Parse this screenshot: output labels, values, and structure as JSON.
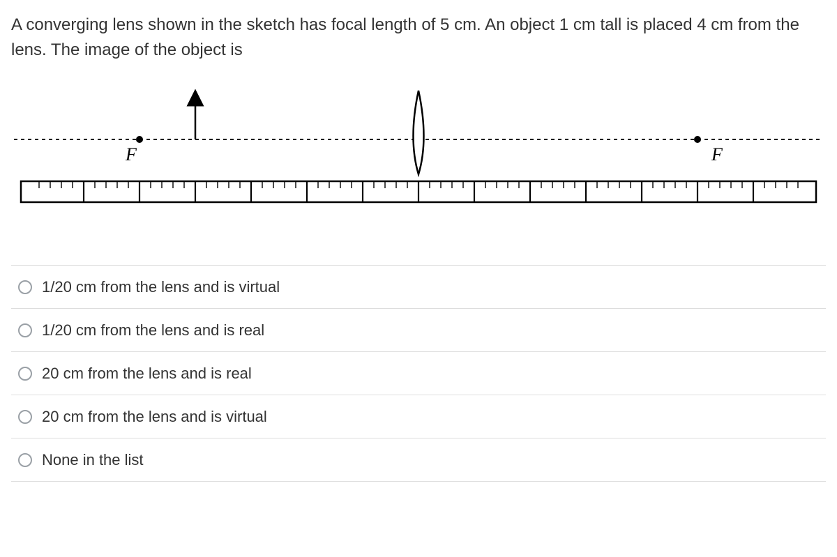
{
  "question": "A converging lens shown in the sketch has focal length of 5 cm. An object 1 cm tall is placed 4 cm from the lens. The image of the object is",
  "labels": {
    "left_focus": "F",
    "right_focus": "F"
  },
  "options": [
    "1/20 cm from the lens and is virtual",
    "1/20 cm from the lens and is real",
    "20 cm from the lens and is real",
    "20 cm from the lens and is virtual",
    "None in the list"
  ],
  "chart_data": {
    "type": "diagram",
    "description": "Converging-lens ray diagram over a ruler",
    "focal_length_cm": 5,
    "object_height_cm": 1,
    "object_distance_cm": 4,
    "lens_position_cm": 0,
    "left_focus_cm": -5,
    "right_focus_cm": 5,
    "ruler_range_cm": [
      -7,
      7
    ],
    "ruler_major_tick_cm": 1
  }
}
